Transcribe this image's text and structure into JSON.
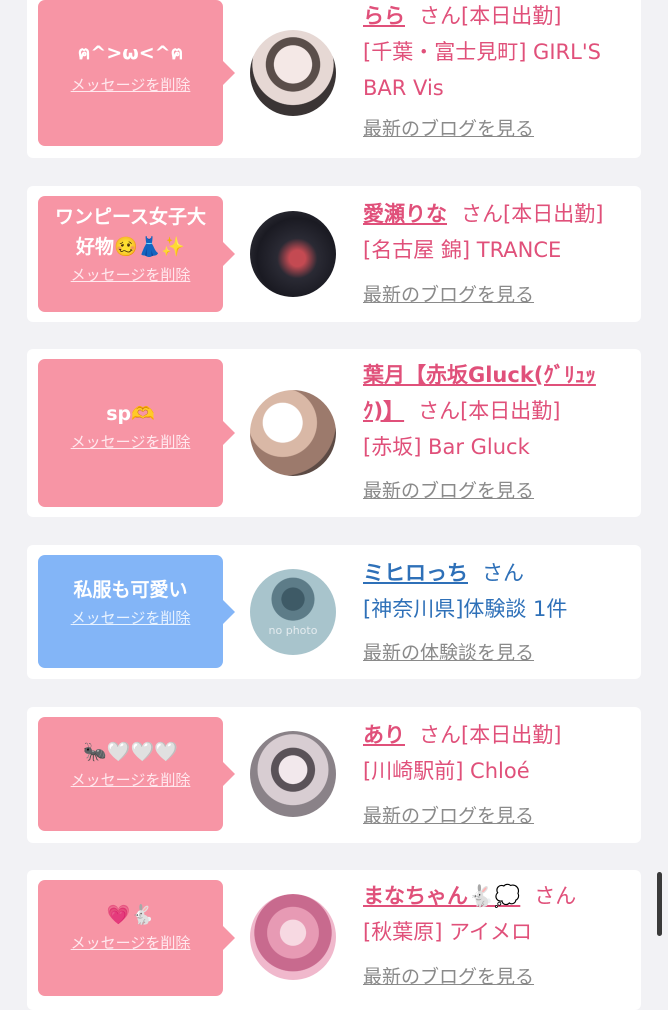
{
  "cards": [
    {
      "message": "ฅ^>ω<^ฅ",
      "delete_label": "メッセージを削除",
      "name": "らら",
      "san": "さん",
      "status": "[本日出勤]",
      "shop": "[千葉・富士見町] GIRL'S BAR Vis",
      "blog_link": "最新のブログを見る"
    },
    {
      "message": "ワンピース女子大好物🥴👗✨",
      "delete_label": "メッセージを削除",
      "name": "愛瀬りな",
      "san": "さん",
      "status": "[本日出勤]",
      "shop": "[名古屋 錦] TRANCE",
      "blog_link": "最新のブログを見る"
    },
    {
      "message": "sp🫶",
      "delete_label": "メッセージを削除",
      "name_line1": "葉月【赤坂Gluck(ｸﾞﾘｭｯ",
      "name_line2": "ｸ)】",
      "san": "さん",
      "status": "[本日出勤]",
      "shop": "[赤坂] Bar Gluck",
      "blog_link": "最新のブログを見る"
    },
    {
      "message": "私服も可愛い",
      "delete_label": "メッセージを削除",
      "name": "ミヒロっち",
      "san": "さん",
      "shop": "[神奈川県]体験談 1件",
      "no_photo": "no photo",
      "blog_link": "最新の体験談を見る"
    },
    {
      "message": "🐜🤍🤍🤍",
      "delete_label": "メッセージを削除",
      "name": "あり",
      "san": "さん",
      "status": "[本日出勤]",
      "shop": "[川崎駅前] Chloé",
      "blog_link": "最新のブログを見る"
    },
    {
      "message": "💗🐇",
      "delete_label": "メッセージを削除",
      "name": "まなちゃん🐇💭",
      "san": "さん",
      "shop": "[秋葉原] アイメロ",
      "blog_link": "最新のブログを見る"
    }
  ],
  "colors": {
    "accent_pink": "#e0507a",
    "bubble_pink": "#f795a5",
    "bubble_blue": "#83b5f7",
    "link_blue": "#2e70b8"
  }
}
